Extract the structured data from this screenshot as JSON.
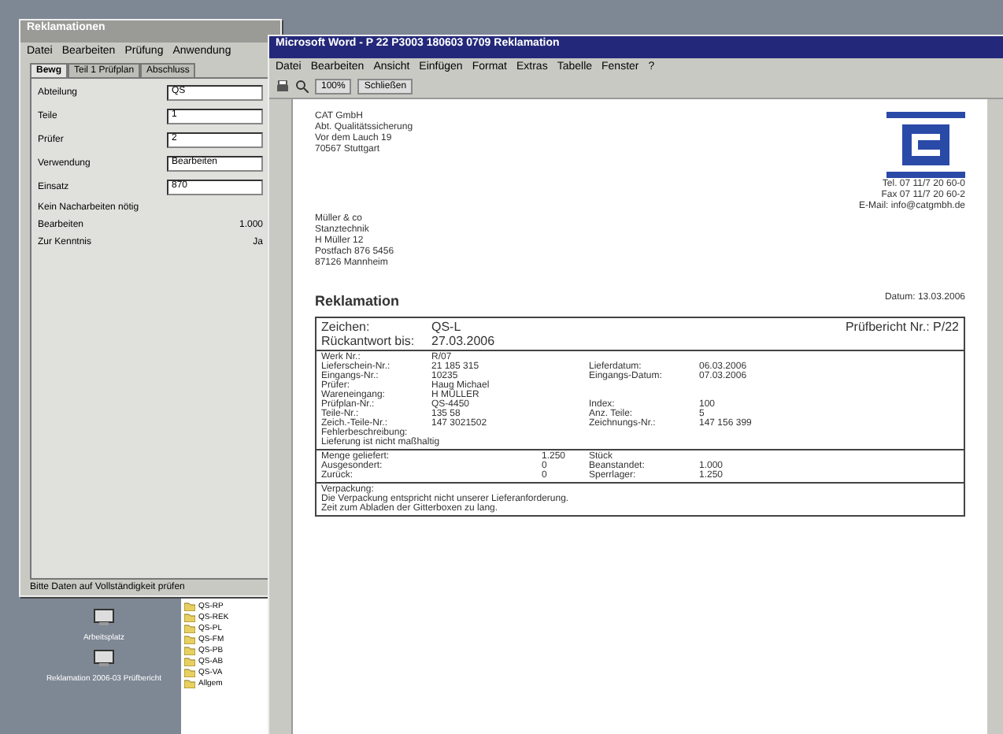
{
  "back_window": {
    "title": "Reklamationen",
    "menu": [
      "Datei",
      "Bearbeiten",
      "Prüfung",
      "Anwendung"
    ],
    "tabs": [
      {
        "label": "Bewg",
        "selected": true
      },
      {
        "label": "Teil 1 Prüfplan",
        "selected": false
      },
      {
        "label": "Abschluss",
        "selected": false
      }
    ],
    "fields": [
      {
        "label": "Abteilung",
        "value": "QS"
      },
      {
        "label": "Teile",
        "value": "1"
      },
      {
        "label": "Prüfer",
        "value": "2"
      },
      {
        "label": "Verwendung",
        "value": "Bearbeiten"
      },
      {
        "label": "Einsatz",
        "value": "870"
      }
    ],
    "notes": [
      {
        "label": "Kein Nacharbeiten nötig"
      },
      {
        "label": "Bearbeiten",
        "value": "1.000"
      },
      {
        "label": "Zur Kenntnis",
        "value": "Ja"
      }
    ],
    "status": "Bitte Daten auf Vollständigkeit prüfen"
  },
  "explorer": {
    "items": [
      "QS-RP",
      "QS-REK",
      "QS-PL",
      "QS-FM",
      "QS-PB",
      "QS-AB",
      "QS-VA",
      "Allgem"
    ]
  },
  "desktop_icons": [
    {
      "label": "Arbeitsplatz"
    },
    {
      "label": "Reklamation 2006-03 Prüfbericht"
    }
  ],
  "word": {
    "title": "Microsoft Word - P 22 P3003 180603 0709 Reklamation",
    "menu": [
      "Datei",
      "Bearbeiten",
      "Ansicht",
      "Einfügen",
      "Format",
      "Extras",
      "Tabelle",
      "Fenster",
      "?"
    ],
    "zoom": "100%",
    "close_label": "Schließen",
    "sender": [
      "CAT GmbH",
      "Abt. Qualitätssicherung",
      "Vor dem Lauch 19",
      "70567 Stuttgart"
    ],
    "contact": [
      "Tel. 07 11/7 20 60-0",
      "Fax 07 11/7 20 60-2",
      "E-Mail: info@catgmbh.de"
    ],
    "recipient": [
      "Müller & co",
      "Stanztechnik",
      "H Müller 12",
      "Postfach 876 5456",
      "87126 Mannheim"
    ],
    "heading": "Reklamation",
    "date": "Datum: 13.03.2006",
    "report": {
      "sign_label": "Zeichen:",
      "sign": "QS-L",
      "report_label": "Prüfbericht Nr.:",
      "report_no": "P/22",
      "reply_label": "Rückantwort bis:",
      "reply": "27.03.2006"
    },
    "rows": [
      {
        "a": "Werk Nr.:",
        "b": "R/07"
      },
      {
        "a": "Lieferschein-Nr.:",
        "b": "21 185 315",
        "c": "Lieferdatum:",
        "d": "06.03.2006"
      },
      {
        "a": "Eingangs-Nr.:",
        "b": "10235",
        "c": "Eingangs-Datum:",
        "d": "07.03.2006"
      },
      {
        "a": "Prüfer:",
        "b": "Haug Michael"
      },
      {
        "a": "Wareneingang:",
        "b": "H MÜLLER"
      },
      {
        "a": "Prüfplan-Nr.:",
        "b": "QS-4450",
        "c": "Index:",
        "d": "100"
      },
      {
        "a": "Teile-Nr.:",
        "b": "135 58",
        "c": "Anz. Teile:",
        "d": "5"
      },
      {
        "a": "Zeich.-Teile-Nr.:",
        "b": "147 3021502",
        "c": "Zeichnungs-Nr.:",
        "d": "147 156 399"
      }
    ],
    "extra": [
      "Fehlerbeschreibung:",
      "Lieferung ist nicht maßhaltig"
    ],
    "qty": [
      {
        "a": "Menge geliefert:",
        "b": "1.250",
        "c": "Stück"
      },
      {
        "a": "Ausgesondert:",
        "b": "0",
        "c": "Beanstandet:",
        "d": "1.000"
      },
      {
        "a": "Zurück:",
        "b": "0",
        "c": "Sperrlager:",
        "d": "1.250"
      }
    ],
    "footer": [
      "Verpackung:",
      "Die Verpackung entspricht nicht unserer Lieferanforderung.",
      "Zeit zum Abladen der Gitterboxen zu lang."
    ]
  }
}
